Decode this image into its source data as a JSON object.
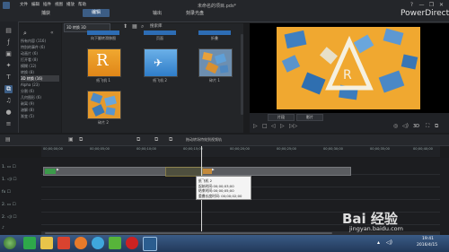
{
  "window": {
    "title": "未命名的项目.pds*",
    "brand": "PowerDirector"
  },
  "window_controls": [
    "?",
    "—",
    "❐",
    "✕"
  ],
  "menu": [
    "文件",
    "编辑",
    "插件",
    "视图",
    "播放",
    "帮助"
  ],
  "top_tabs": {
    "capture": "捕获",
    "edit": "编辑",
    "produce": "输出",
    "disc": "刻录光盘"
  },
  "categories": [
    "所有内容 (116)",
    "特别的事件 (6)",
    "动画片 (6)",
    "打开看 (8)",
    "模糊 (12)",
    "转换 (8)",
    "3D 转换 (16)",
    "Alpha (23)",
    "分割 (6)",
    "几何图形 (6)",
    "剥离 (9)",
    "溶解 (8)",
    "渐变 (5)"
  ],
  "library": {
    "filter_value": "3D 转换 3D",
    "top_labels": [
      "向下翻转滑移图",
      "页面",
      "折叠"
    ],
    "thumbs": [
      {
        "label": "纸飞机 1"
      },
      {
        "label": "纸飞机 2"
      },
      {
        "label": "碎片 1"
      },
      {
        "label": "碎片 2"
      }
    ]
  },
  "preview": {
    "clip_btn": "片段",
    "movie_btn": "影片",
    "mode_3d": "3D"
  },
  "timeline": {
    "hint": "拖动转场特效到视频轨",
    "ruler": [
      "00;00;00;00",
      "00;00;05;00",
      "00;00;10;00",
      "00;00;15;00",
      "00;00;20;00",
      "00;00;25;00",
      "00;00;30;00",
      "00;00;35;00",
      "00;00;40;00"
    ],
    "tracks": [
      "1.",
      "1.",
      "fx",
      "2.",
      "2.",
      "♪"
    ],
    "clip1": "▶",
    "clip2": "▶",
    "tooltip": [
      "纸飞机 2",
      "起始时间:00;00;03;00",
      "结束时间:00;00;05;00",
      "重叠长度时间: 00;00;02;00"
    ]
  },
  "taskbar": {
    "time": "19:41",
    "date": "2016/4/15"
  },
  "watermark": {
    "text": "Bai 经验",
    "sub": "jingyan.baidu.com"
  },
  "colors": {
    "accent": "#3c5d85",
    "timeline_clip": "#5a5c60",
    "taskbar": "#2b4a72"
  }
}
